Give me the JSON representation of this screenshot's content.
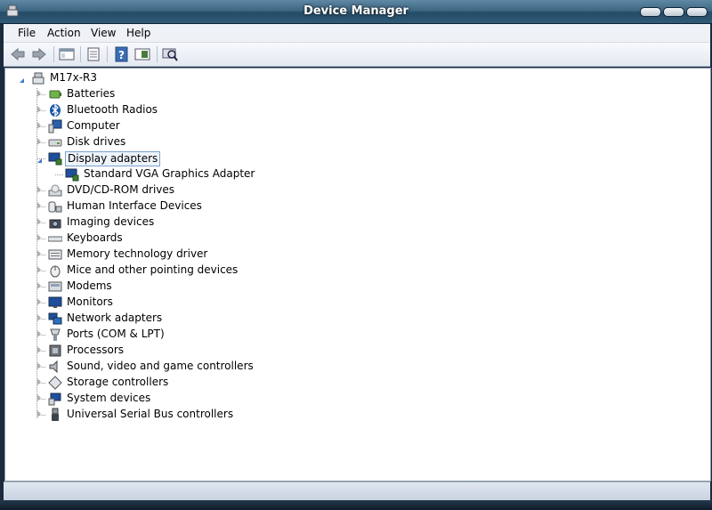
{
  "window": {
    "title": "Device Manager"
  },
  "menu": [
    "File",
    "Action",
    "View",
    "Help"
  ],
  "tree": {
    "root": "M17x-R3",
    "categories": [
      {
        "label": "Batteries",
        "icon": "battery-icon"
      },
      {
        "label": "Bluetooth Radios",
        "icon": "bluetooth-icon"
      },
      {
        "label": "Computer",
        "icon": "computer-icon"
      },
      {
        "label": "Disk drives",
        "icon": "disk-drive-icon"
      },
      {
        "label": "Display adapters",
        "icon": "display-adapter-icon",
        "expanded": true,
        "selected": true,
        "children": [
          {
            "label": "Standard VGA Graphics Adapter",
            "icon": "display-adapter-icon"
          }
        ]
      },
      {
        "label": "DVD/CD-ROM drives",
        "icon": "dvd-drive-icon"
      },
      {
        "label": "Human Interface Devices",
        "icon": "hid-icon"
      },
      {
        "label": "Imaging devices",
        "icon": "camera-icon"
      },
      {
        "label": "Keyboards",
        "icon": "keyboard-icon"
      },
      {
        "label": "Memory technology driver",
        "icon": "memory-icon"
      },
      {
        "label": "Mice and other pointing devices",
        "icon": "mouse-icon"
      },
      {
        "label": "Modems",
        "icon": "modem-icon"
      },
      {
        "label": "Monitors",
        "icon": "monitor-icon"
      },
      {
        "label": "Network adapters",
        "icon": "network-adapter-icon"
      },
      {
        "label": "Ports (COM & LPT)",
        "icon": "port-icon"
      },
      {
        "label": "Processors",
        "icon": "processor-icon"
      },
      {
        "label": "Sound, video and game controllers",
        "icon": "speaker-icon"
      },
      {
        "label": "Storage controllers",
        "icon": "storage-controller-icon"
      },
      {
        "label": "System devices",
        "icon": "system-device-icon"
      },
      {
        "label": "Universal Serial Bus controllers",
        "icon": "usb-icon"
      }
    ]
  },
  "colors": {
    "selection_border": "#7da2ce",
    "titlebar": "#3e6783"
  }
}
